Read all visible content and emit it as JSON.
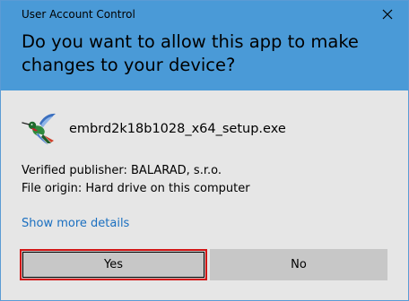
{
  "window": {
    "title": "User Account Control"
  },
  "header": {
    "question": "Do you want to allow this app to make changes to your device?"
  },
  "app": {
    "icon": "hummingbird-icon",
    "name": "embrd2k18b1028_x64_setup.exe"
  },
  "details": {
    "publisher": "Verified publisher: BALARAD, s.r.o.",
    "origin": "File origin: Hard drive on this computer"
  },
  "links": {
    "show_more": "Show more details"
  },
  "buttons": {
    "yes_label": "Yes",
    "no_label": "No"
  },
  "colors": {
    "header_bg": "#4a9ad7",
    "body_bg": "#e6e6e6",
    "button_bg": "#c7c7c7",
    "focus_border": "#d21414",
    "link": "#1a6fc0"
  }
}
